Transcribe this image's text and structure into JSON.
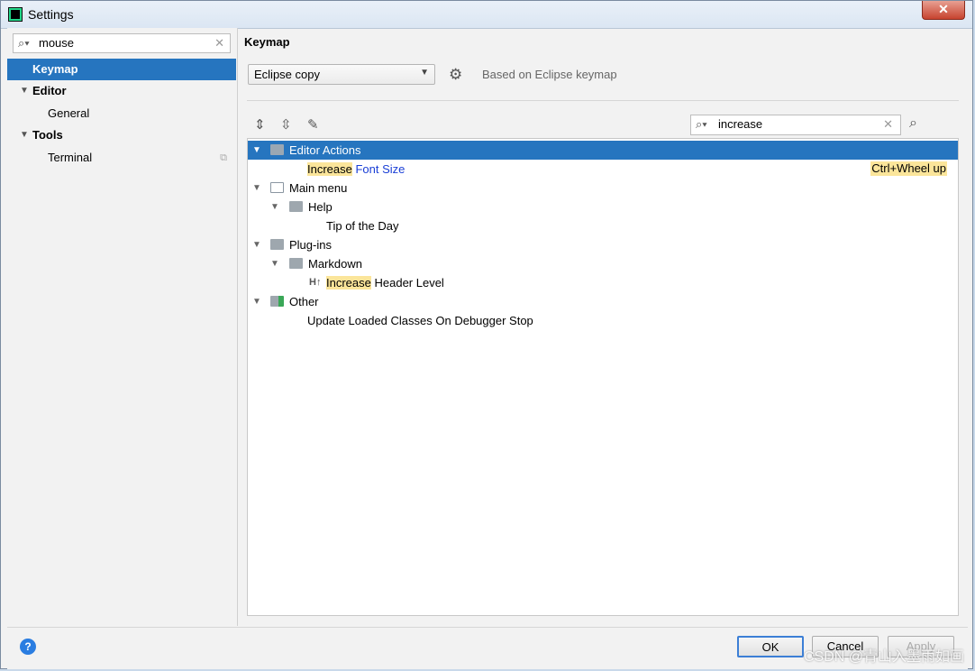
{
  "window": {
    "title": "Settings",
    "close_label": "✕"
  },
  "sidebar": {
    "search": {
      "value": "mouse"
    },
    "items": [
      {
        "label": "Keymap"
      },
      {
        "label": "Editor"
      },
      {
        "label": "General"
      },
      {
        "label": "Tools"
      },
      {
        "label": "Terminal"
      }
    ]
  },
  "keymap": {
    "title": "Keymap",
    "selected": "Eclipse copy",
    "based_on": "Based on Eclipse keymap",
    "filter": {
      "value": "increase"
    }
  },
  "tree": {
    "editor_actions": "Editor Actions",
    "font_size": {
      "highlight": "Increase",
      "rest": " Font Size",
      "shortcut": "Ctrl+Wheel up"
    },
    "main_menu": "Main menu",
    "help": "Help",
    "tip": "Tip of the Day",
    "plugins": "Plug-ins",
    "markdown": "Markdown",
    "header_level": {
      "icon": "H↑",
      "highlight": "Increase",
      "rest": " Header Level"
    },
    "other": "Other",
    "update_classes": "Update Loaded Classes On Debugger Stop"
  },
  "footer": {
    "ok": "OK",
    "cancel": "Cancel",
    "apply": "Apply",
    "help": "?"
  },
  "watermark": "CSDN @青山入墨雨如画"
}
